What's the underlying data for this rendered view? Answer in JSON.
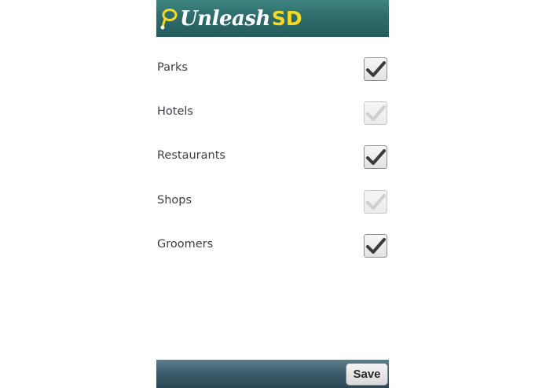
{
  "header": {
    "logo_main": "Unleash",
    "logo_accent": "SD",
    "logo_icon": "leash-icon",
    "colors": {
      "bar": "#2d6d6c",
      "accent": "#f4da23"
    }
  },
  "filters": [
    {
      "label": "Parks",
      "checked": true
    },
    {
      "label": "Hotels",
      "checked": false
    },
    {
      "label": "Restaurants",
      "checked": true
    },
    {
      "label": "Shops",
      "checked": false
    },
    {
      "label": "Groomers",
      "checked": true
    }
  ],
  "footer": {
    "save_label": "Save",
    "colors": {
      "bar": "#3b5a69"
    }
  }
}
